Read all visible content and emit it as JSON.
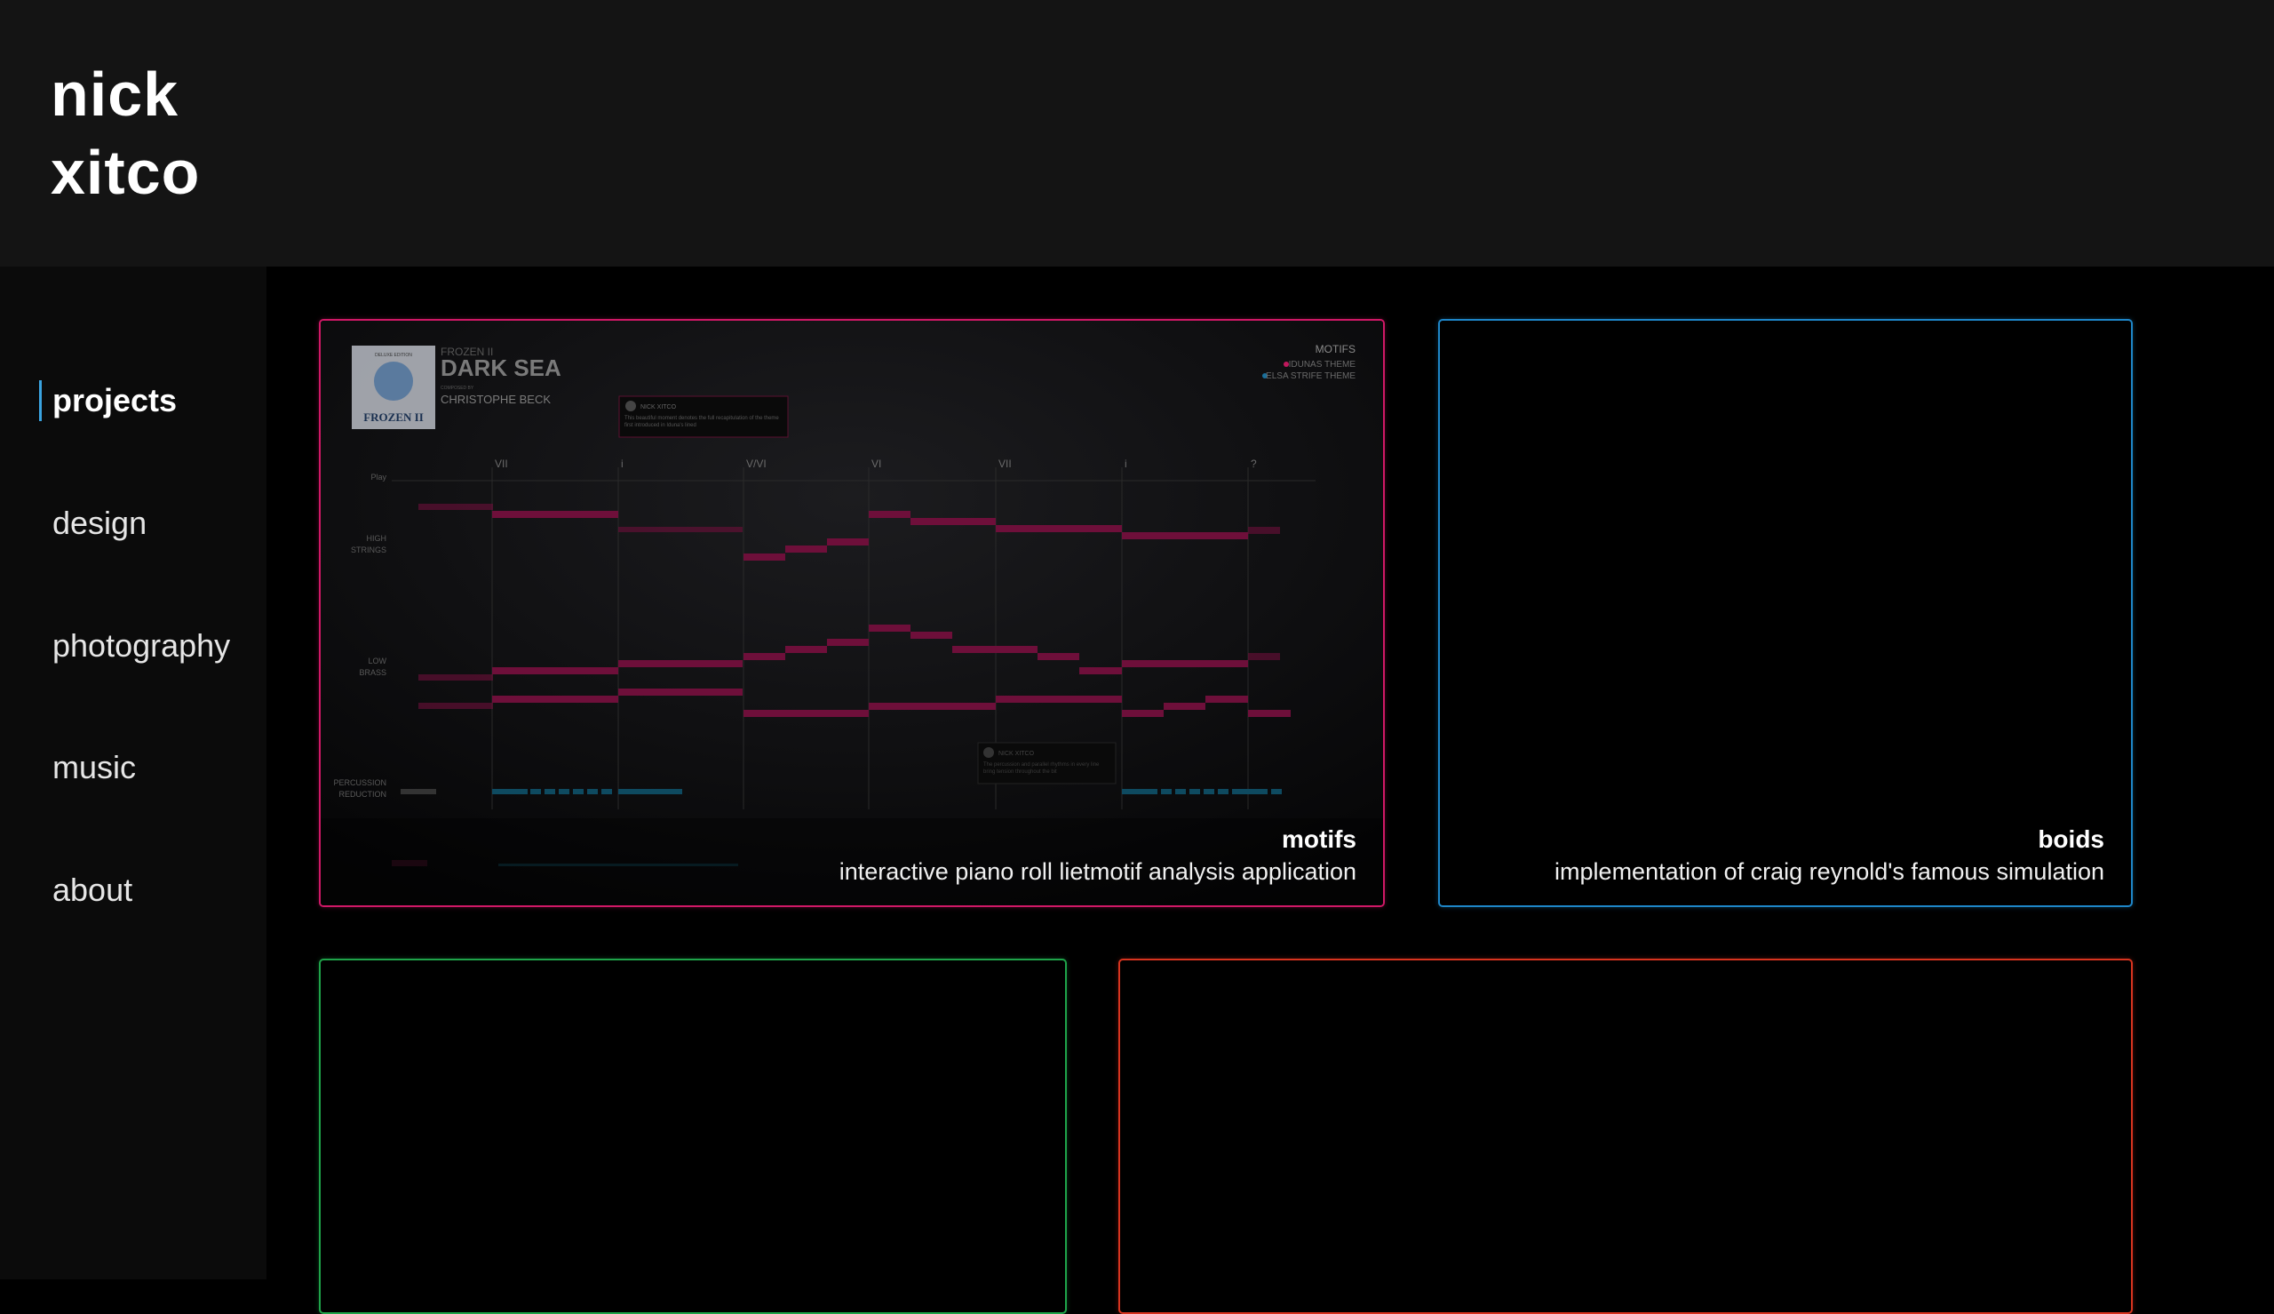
{
  "brand": {
    "line1": "nick",
    "line2": "xitco"
  },
  "nav": {
    "items": [
      {
        "label": "projects",
        "active": true
      },
      {
        "label": "design",
        "active": false
      },
      {
        "label": "photography",
        "active": false
      },
      {
        "label": "music",
        "active": false
      },
      {
        "label": "about",
        "active": false
      }
    ]
  },
  "cards": [
    {
      "title": "motifs",
      "description": "interactive piano roll lietmotif analysis application",
      "border_color": "#d01866",
      "preview": {
        "album_art": {
          "edition": "DELUXE EDITION",
          "logo_text": "FROZEN II"
        },
        "subtitle": "FROZEN II",
        "song_title": "DARK SEA",
        "composer_label": "COMPOSED BY",
        "composer": "CHRISTOPHE BECK",
        "legend_title": "MOTIFS",
        "legend": [
          {
            "name": "IDUNAS THEME",
            "color": "#c0185c"
          },
          {
            "name": "ELSA STRIFE THEME",
            "color": "#1a6f9a"
          }
        ],
        "comments": [
          {
            "author": "NICK XITCO",
            "text": "This beautiful moment denotes the full recapitulation of the theme first introduced in Iduna's lined"
          },
          {
            "author": "NICK XITCO",
            "text": "The percussion and parallel rhythms in every line bring tension throughout the bit"
          }
        ],
        "chords": [
          "VII",
          "i",
          "V/VI",
          "VI",
          "VII",
          "i",
          "?"
        ],
        "row_labels": [
          {
            "line1": "Play",
            "line2": ""
          },
          {
            "line1": "HIGH",
            "line2": "STRINGS"
          },
          {
            "line1": "LOW",
            "line2": "BRASS"
          },
          {
            "line1": "PERCUSSION",
            "line2": "REDUCTION"
          }
        ]
      }
    },
    {
      "title": "boids",
      "description": "implementation of craig reynold's famous simulation",
      "border_color": "#1e86c8"
    },
    {
      "title": "",
      "description": "",
      "border_color": "#1fa44a"
    },
    {
      "title": "",
      "description": "",
      "border_color": "#d8341f"
    }
  ]
}
